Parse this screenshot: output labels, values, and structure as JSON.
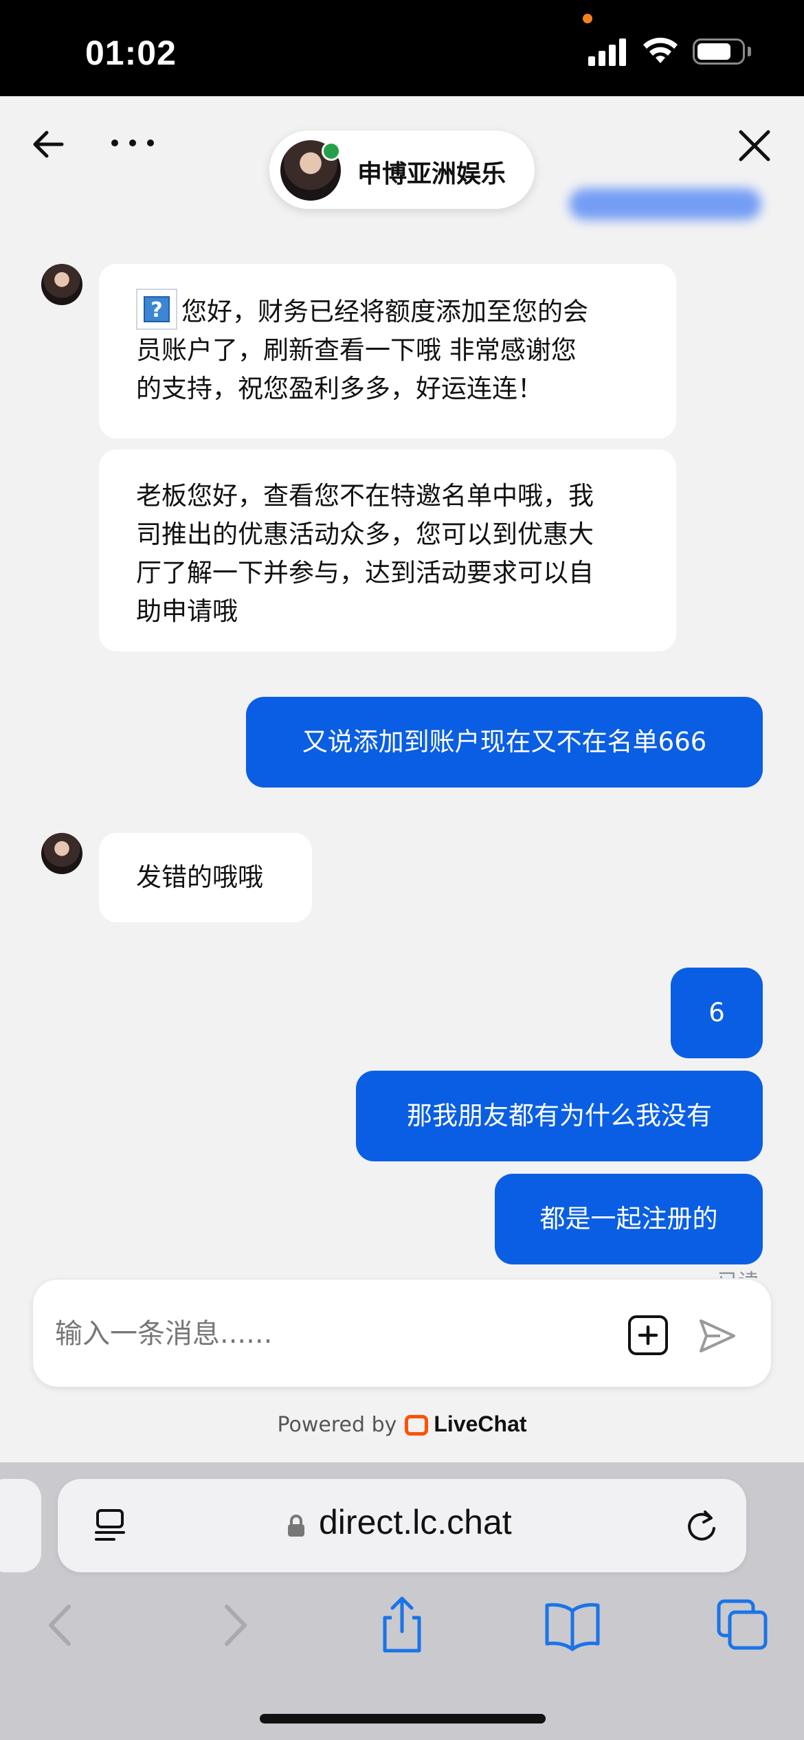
{
  "status_bar": {
    "time": "01:02"
  },
  "chat_header": {
    "agent_name": "申博亚洲娱乐"
  },
  "messages": [
    {
      "from": "agent",
      "text": "您好，财务已经将额度添加至您的会员账户了，刷新查看一下哦 非常感谢您的支持，祝您盈利多多，好运连连！",
      "lines": [
        "您好，财务已经将额度添加至您的会",
        "员账户了，刷新查看一下哦 非常感谢您",
        "的支持，祝您盈利多多，好运连连！"
      ]
    },
    {
      "from": "agent",
      "text": "老板您好，查看您不在特邀名单中哦，我司推出的优惠活动众多，您可以到优惠大厅了解一下并参与，达到活动要求可以自助申请哦",
      "lines": [
        "老板您好，查看您不在特邀名单中哦，我",
        "司推出的优惠活动众多，您可以到优惠大",
        "厅了解一下并参与，达到活动要求可以自",
        "助申请哦"
      ]
    },
    {
      "from": "visitor",
      "text": "又说添加到账户现在又不在名单666"
    },
    {
      "from": "agent",
      "text": "发错的哦哦"
    },
    {
      "from": "visitor",
      "text": "6"
    },
    {
      "from": "visitor",
      "text": "那我朋友都有为什么我没有"
    },
    {
      "from": "visitor",
      "text": "都是一起注册的"
    }
  ],
  "read_receipt": "已读",
  "composer": {
    "placeholder": "输入一条消息......"
  },
  "footer": {
    "powered_by": "Powered by",
    "brand": "LiveChat"
  },
  "browser": {
    "url": "direct.lc.chat"
  },
  "colors": {
    "visitor_bubble": "#0a5ee3",
    "agent_bubble": "#ffffff",
    "online": "#24a148",
    "livechat_brand": "#ff5100"
  }
}
